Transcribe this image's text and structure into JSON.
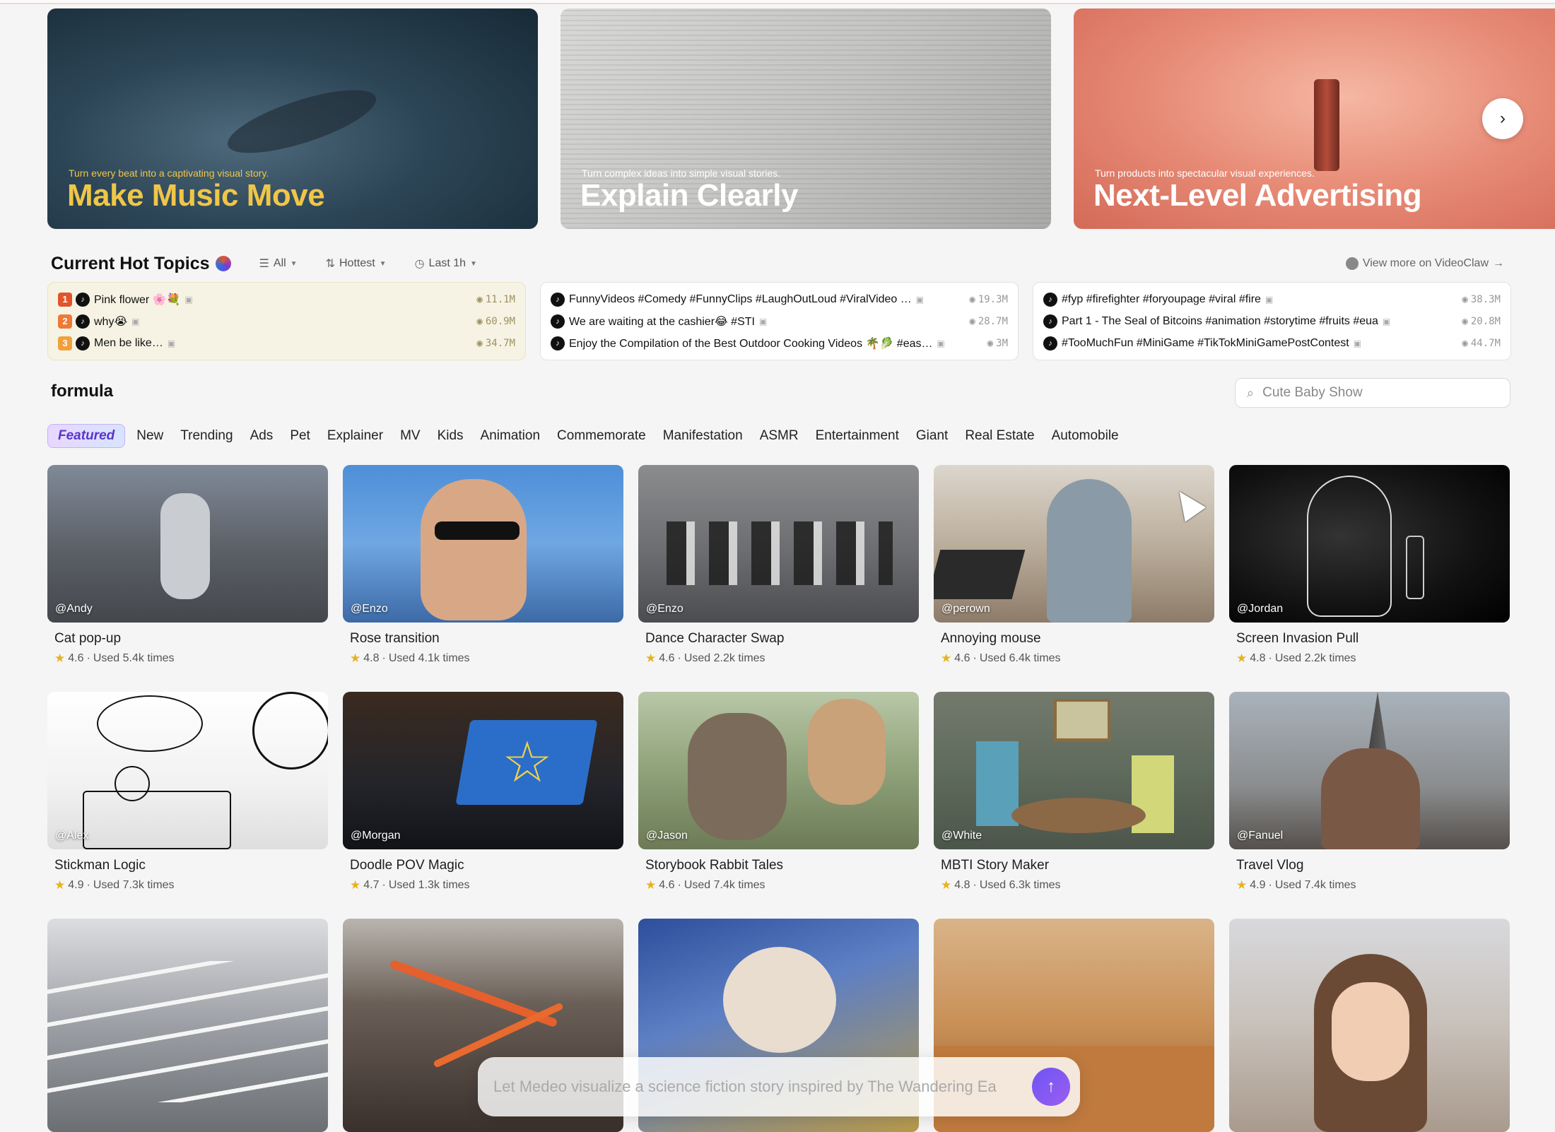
{
  "hero": {
    "banners": [
      {
        "subtitle": "Turn every beat into a captivating visual story.",
        "title": "Make Music Move"
      },
      {
        "subtitle": "Turn complex ideas into simple visual stories.",
        "title": "Explain Clearly"
      },
      {
        "subtitle": "Turn products into spectacular visual experiences.",
        "title": "Next-Level Advertising"
      }
    ],
    "next_icon": "chevron-right-icon"
  },
  "hot_topics": {
    "title": "Current Hot Topics",
    "filters": {
      "platform": "All",
      "sort": "Hottest",
      "time": "Last 1h"
    },
    "view_more": "View more on VideoClaw",
    "cards": [
      {
        "rows": [
          {
            "rank": "1",
            "text": "Pink flower 🌸💐",
            "views": "11.1M"
          },
          {
            "rank": "2",
            "text": "why😭",
            "views": "60.9M"
          },
          {
            "rank": "3",
            "text": "Men be like…",
            "views": "34.7M"
          }
        ]
      },
      {
        "rows": [
          {
            "text": "FunnyVideos #Comedy #FunnyClips #LaughOutLoud #ViralVideo …",
            "views": "19.3M"
          },
          {
            "text": "We are waiting at the cashier😂 #STI",
            "views": "28.7M"
          },
          {
            "text": "Enjoy the Compilation of the Best Outdoor Cooking Videos 🌴🥬 #eas…",
            "views": "3M"
          }
        ]
      },
      {
        "rows": [
          {
            "text": "#fyp #firefighter #foryoupage #viral #fire",
            "views": "38.3M"
          },
          {
            "text": "Part 1 - The Seal of Bitcoins #animation #storytime #fruits #eua",
            "views": "20.8M"
          },
          {
            "text": "#TooMuchFun #MiniGame #TikTokMiniGamePostContest",
            "views": "44.7M"
          }
        ]
      }
    ]
  },
  "formula": {
    "title": "formula",
    "search_placeholder": "Cute Baby Show",
    "tabs": [
      "Featured",
      "New",
      "Trending",
      "Ads",
      "Pet",
      "Explainer",
      "MV",
      "Kids",
      "Animation",
      "Commemorate",
      "Manifestation",
      "ASMR",
      "Entertainment",
      "Giant",
      "Real Estate",
      "Automobile"
    ],
    "items": [
      {
        "author": "@Andy",
        "title": "Cat pop-up",
        "rating": "4.6",
        "used": "Used 5.4k times"
      },
      {
        "author": "@Enzo",
        "title": "Rose transition",
        "rating": "4.8",
        "used": "Used 4.1k times"
      },
      {
        "author": "@Enzo",
        "title": "Dance Character Swap",
        "rating": "4.6",
        "used": "Used 2.2k times"
      },
      {
        "author": "@perown",
        "title": "Annoying mouse",
        "rating": "4.6",
        "used": "Used 6.4k times"
      },
      {
        "author": "@Jordan",
        "title": "Screen Invasion Pull",
        "rating": "4.8",
        "used": "Used 2.2k times"
      },
      {
        "author": "@Alex",
        "title": "Stickman Logic",
        "rating": "4.9",
        "used": "Used 7.3k times"
      },
      {
        "author": "@Morgan",
        "title": "Doodle POV Magic",
        "rating": "4.7",
        "used": "Used 1.3k times"
      },
      {
        "author": "@Jason",
        "title": "Storybook Rabbit Tales",
        "rating": "4.6",
        "used": "Used 7.4k times"
      },
      {
        "author": "@White",
        "title": "MBTI Story Maker",
        "rating": "4.8",
        "used": "Used 6.3k times"
      },
      {
        "author": "@Fanuel",
        "title": "Travel Vlog",
        "rating": "4.9",
        "used": "Used 7.4k times"
      }
    ]
  },
  "prompt": {
    "placeholder": "Let Medeo visualize a science fiction story inspired by The Wandering Ea",
    "send_icon": "arrow-up-icon"
  },
  "colors": {
    "accent": "#7b5cf2",
    "star": "#e8b21d",
    "music_title": "#f0c648"
  }
}
